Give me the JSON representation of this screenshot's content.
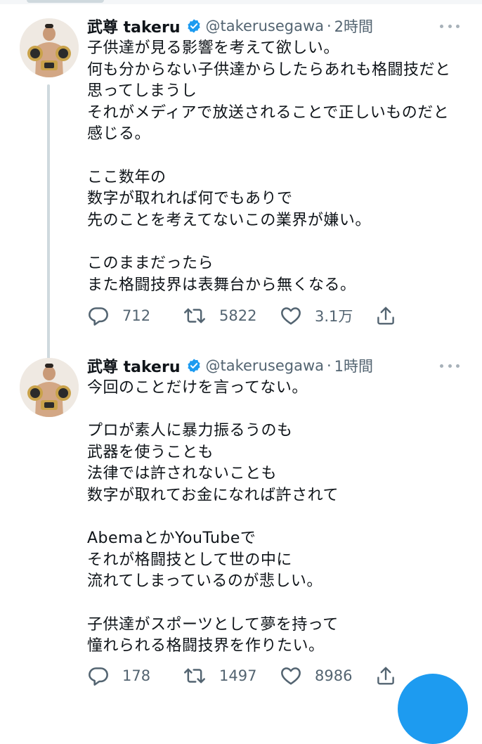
{
  "tweets": [
    {
      "display_name": "武尊 takeru",
      "verified_icon": "verified-badge-icon",
      "handle": "@takerusegawa",
      "separator": "·",
      "time": "2時間",
      "body_lines": [
        "子供達が見る影響を考えて欲しい。",
        "何も分からない子供達からしたらあれも格闘技だと",
        "思ってしまうし",
        "それがメディアで放送されることで正しいものだと",
        "感じる。",
        "",
        "ここ数年の",
        "数字が取れれば何でもありで",
        "先のことを考えてないこの業界が嫌い。",
        "",
        "このままだったら",
        "また格闘技界は表舞台から無くなる。"
      ],
      "replies": "712",
      "retweets": "5822",
      "likes": "3.1万"
    },
    {
      "display_name": "武尊 takeru",
      "verified_icon": "verified-badge-icon",
      "handle": "@takerusegawa",
      "separator": "·",
      "time": "1時間",
      "body_lines": [
        "今回のことだけを言ってない。",
        "",
        "プロが素人に暴力振るうのも",
        "武器を使うことも",
        "法律では許されないことも",
        "数字が取れてお金になれば許されて",
        "",
        "AbemaとかYouTubeで",
        "それが格闘技として世の中に",
        "流れてしまっているのが悲しい。",
        "",
        "子供達がスポーツとして夢を持って",
        "憧れられる格闘技界を作りたい。"
      ],
      "replies": "178",
      "retweets": "1497",
      "likes": "8986"
    }
  ],
  "icons": {
    "reply": "reply-icon",
    "retweet": "retweet-icon",
    "like": "like-icon",
    "share": "share-icon",
    "more": "more-icon",
    "compose": "compose-fab"
  },
  "colors": {
    "verified": "#1d9bf0",
    "secondary_text": "#536471",
    "thread_line": "#cfd9de",
    "fab": "#1d9bf0"
  }
}
